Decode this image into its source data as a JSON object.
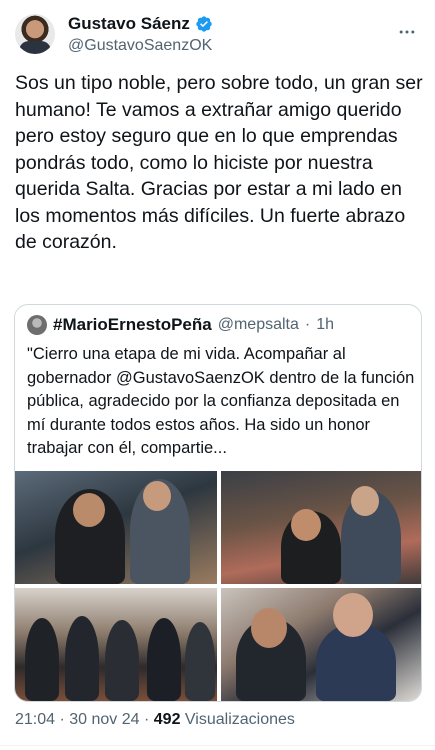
{
  "author": {
    "display_name": "Gustavo Sáenz",
    "handle": "@GustavoSaenzOK",
    "verified": true
  },
  "tweet": {
    "text": "Sos un tipo noble, pero sobre todo, un gran ser humano! Te vamos a extrañar amigo querido pero estoy seguro que en lo que emprendas pondrás todo, como lo hiciste por nuestra querida Salta. Gracias por estar a mi lado en los momentos más difíciles. Un fuerte abrazo de corazón."
  },
  "quote": {
    "display_name": "#MarioErnestoPeña",
    "handle": "@mepsalta",
    "separator": "·",
    "time": "1h",
    "text": "\"Cierro una etapa de mi vida.  Acompañar al gobernador @GustavoSaenzOK dentro de la función pública, agradecido por la confianza depositada en mí durante todos estos años. Ha sido un honor trabajar con él, compartie...",
    "media_count": 4
  },
  "footer": {
    "time": "21:04",
    "separator": " · ",
    "date": "30 nov 24",
    "views_count": "492",
    "views_label": "Visualizaciones"
  },
  "icons": {
    "verified": "verified-badge-icon",
    "more": "more-horizontal-icon"
  },
  "colors": {
    "verified_blue": "#1d9bf0",
    "secondary_text": "#536471",
    "border": "#cfd9de"
  }
}
